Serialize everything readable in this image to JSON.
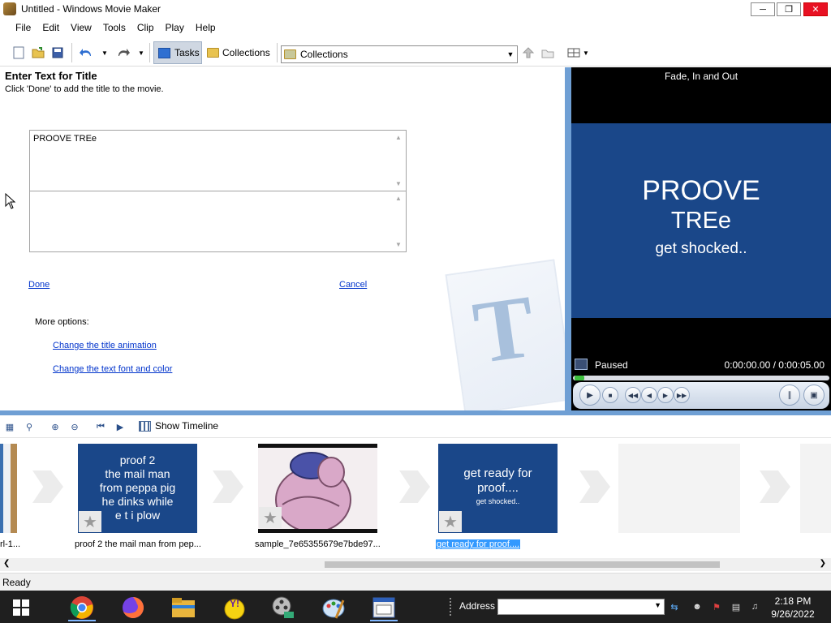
{
  "window": {
    "title": "Untitled - Windows Movie Maker"
  },
  "menu": [
    "File",
    "Edit",
    "View",
    "Tools",
    "Clip",
    "Play",
    "Help"
  ],
  "toolbar": {
    "tasks_label": "Tasks",
    "collections_label": "Collections",
    "collection_select_value": "Collections"
  },
  "task_pane": {
    "heading": "Enter Text for Title",
    "subheading": "Click 'Done' to add the title to the movie.",
    "title_text": "PROOVE TREe",
    "subtitle_text": "",
    "done_label": "Done",
    "cancel_label": "Cancel",
    "more_options_label": "More options:",
    "change_animation_label": "Change the title animation",
    "change_font_label": "Change the text font and color"
  },
  "monitor": {
    "title": "Fade, In and Out",
    "preview_line1": "PROOVE",
    "preview_line2": "TREe",
    "preview_line3": "get shocked..",
    "status": "Paused",
    "time": "0:00:00.00 / 0:00:05.00",
    "progress_fraction": 0.0
  },
  "storyboard_toolbar": {
    "show_timeline_label": "Show Timeline"
  },
  "storyboard": {
    "clips": [
      {
        "label": "rl-1...",
        "thumb_text": []
      },
      {
        "label": "proof 2 the mail man from pep...",
        "thumb_text": [
          "proof 2",
          "the mail man",
          "from peppa pig",
          "he dinks while",
          "e t  i plow"
        ]
      },
      {
        "label": "sample_7e65355679e7bde97...",
        "thumb_text": []
      },
      {
        "label": "get ready for proof....",
        "thumb_text": [
          "get ready for",
          "proof....",
          "get shocked.."
        ]
      }
    ]
  },
  "status_bar": {
    "text": "Ready"
  },
  "taskbar": {
    "address_label": "Address",
    "clock_time": "2:18 PM",
    "clock_date": "9/26/2022"
  },
  "colors": {
    "accent_blue": "#1a4789",
    "splitter": "#6f9fd4",
    "link": "#0033cc"
  }
}
